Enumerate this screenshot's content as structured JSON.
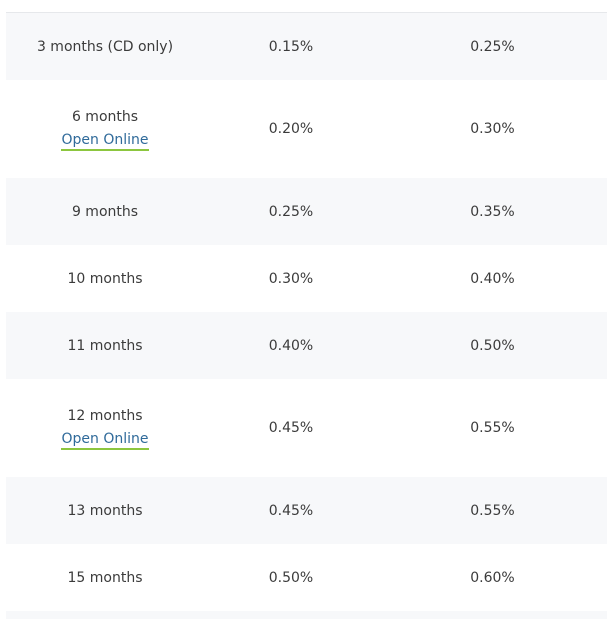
{
  "rates_table": {
    "link_label": "Open Online",
    "rows": [
      {
        "term": "3 months (CD only)",
        "rate_a": "0.15%",
        "rate_b": "0.25%",
        "has_link": false
      },
      {
        "term": "6 months",
        "rate_a": "0.20%",
        "rate_b": "0.30%",
        "has_link": true
      },
      {
        "term": "9 months",
        "rate_a": "0.25%",
        "rate_b": "0.35%",
        "has_link": false
      },
      {
        "term": "10 months",
        "rate_a": "0.30%",
        "rate_b": "0.40%",
        "has_link": false
      },
      {
        "term": "11 months",
        "rate_a": "0.40%",
        "rate_b": "0.50%",
        "has_link": false
      },
      {
        "term": "12 months",
        "rate_a": "0.45%",
        "rate_b": "0.55%",
        "has_link": true
      },
      {
        "term": "13 months",
        "rate_a": "0.45%",
        "rate_b": "0.55%",
        "has_link": false
      },
      {
        "term": "15 months",
        "rate_a": "0.50%",
        "rate_b": "0.60%",
        "has_link": false
      }
    ]
  },
  "colors": {
    "shaded_row": "#f7f8fa",
    "link_text": "#2f6a9a",
    "link_underline": "#8cc63f"
  }
}
